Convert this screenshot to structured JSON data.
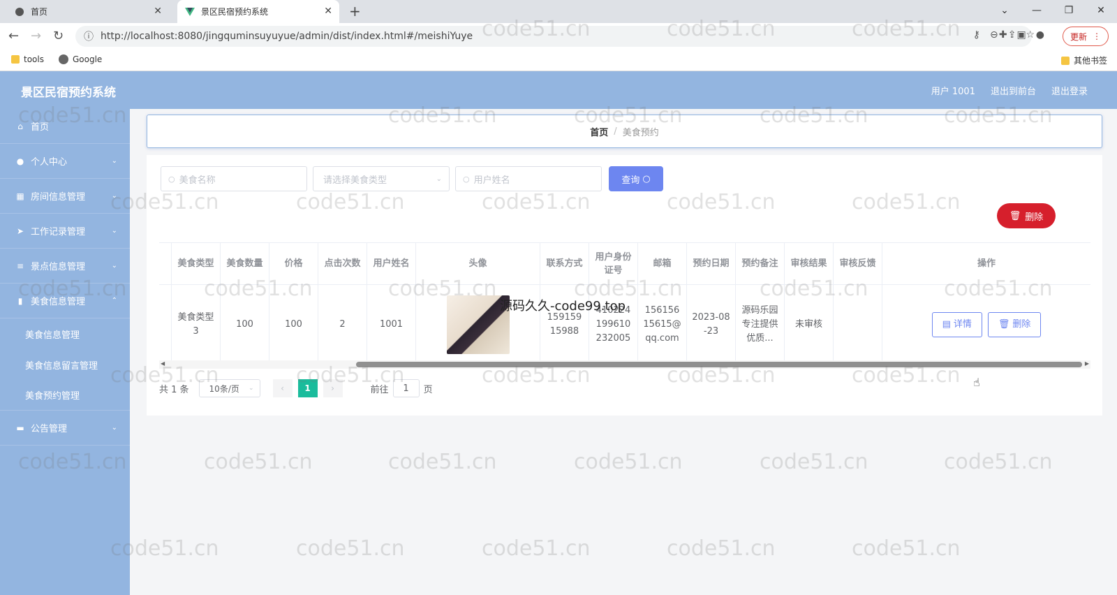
{
  "browser": {
    "tabs": [
      {
        "label": "首页",
        "icon": "globe-icon"
      },
      {
        "label": "景区民宿预约系统",
        "icon": "vue-icon"
      }
    ],
    "url": "http://localhost:8080/jingquminsuyuyue/admin/dist/index.html#/meishiYuye",
    "update_label": "更新",
    "bookmarks": [
      {
        "label": "tools",
        "icon": "folder-icon"
      },
      {
        "label": "Google",
        "icon": "globe-icon"
      }
    ],
    "other_bookmarks": "其他书签"
  },
  "app": {
    "title": "景区民宿预约系统",
    "user": "用户 1001",
    "exit_front": "退出到前台",
    "logout": "退出登录"
  },
  "sidebar": {
    "items": [
      {
        "label": "首页",
        "icon": "home-icon"
      },
      {
        "label": "个人中心",
        "icon": "user-icon"
      },
      {
        "label": "房间信息管理",
        "icon": "grid-icon"
      },
      {
        "label": "工作记录管理",
        "icon": "send-icon"
      },
      {
        "label": "景点信息管理",
        "icon": "list-icon"
      },
      {
        "label": "美食信息管理",
        "icon": "chart-icon"
      },
      {
        "label": "公告管理",
        "icon": "monitor-icon"
      }
    ],
    "subitems": [
      "美食信息管理",
      "美食信息留言管理",
      "美食预约管理"
    ]
  },
  "breadcrumb": {
    "home": "首页",
    "separator": "/",
    "current": "美食预约"
  },
  "search": {
    "name_placeholder": "美食名称",
    "type_placeholder": "请选择美食类型",
    "user_placeholder": "用户姓名",
    "query_label": "查询"
  },
  "actions": {
    "delete_label": "删除"
  },
  "table": {
    "columns": [
      "美食类型",
      "美食数量",
      "价格",
      "点击次数",
      "用户姓名",
      "头像",
      "联系方式",
      "用户身份证号",
      "邮箱",
      "预约日期",
      "预约备注",
      "审核结果",
      "审核反馈",
      "操作"
    ],
    "rows": [
      {
        "type": "美食类型3",
        "quantity": "100",
        "price": "100",
        "clicks": "2",
        "username": "1001",
        "phone": "15915915988",
        "idcard": "410224199610232005",
        "email": "15615615615@qq.com",
        "date": "2023-08-23",
        "note": "源码乐园专注提供优质...",
        "audit": "未审核",
        "feedback": "",
        "detail_label": "详情",
        "delete_label": "删除"
      }
    ]
  },
  "pagination": {
    "total": "共 1 条",
    "page_size": "10条/页",
    "current": "1",
    "goto": "前往",
    "goto_value": "1",
    "page_unit": "页"
  },
  "overlay_text": "源码久久-code99.top",
  "watermark": "code51.cn",
  "colors": {
    "primary": "#93b5e0",
    "accent": "#6d86f0",
    "danger": "#d61f2c",
    "page_active": "#1abc9c"
  }
}
